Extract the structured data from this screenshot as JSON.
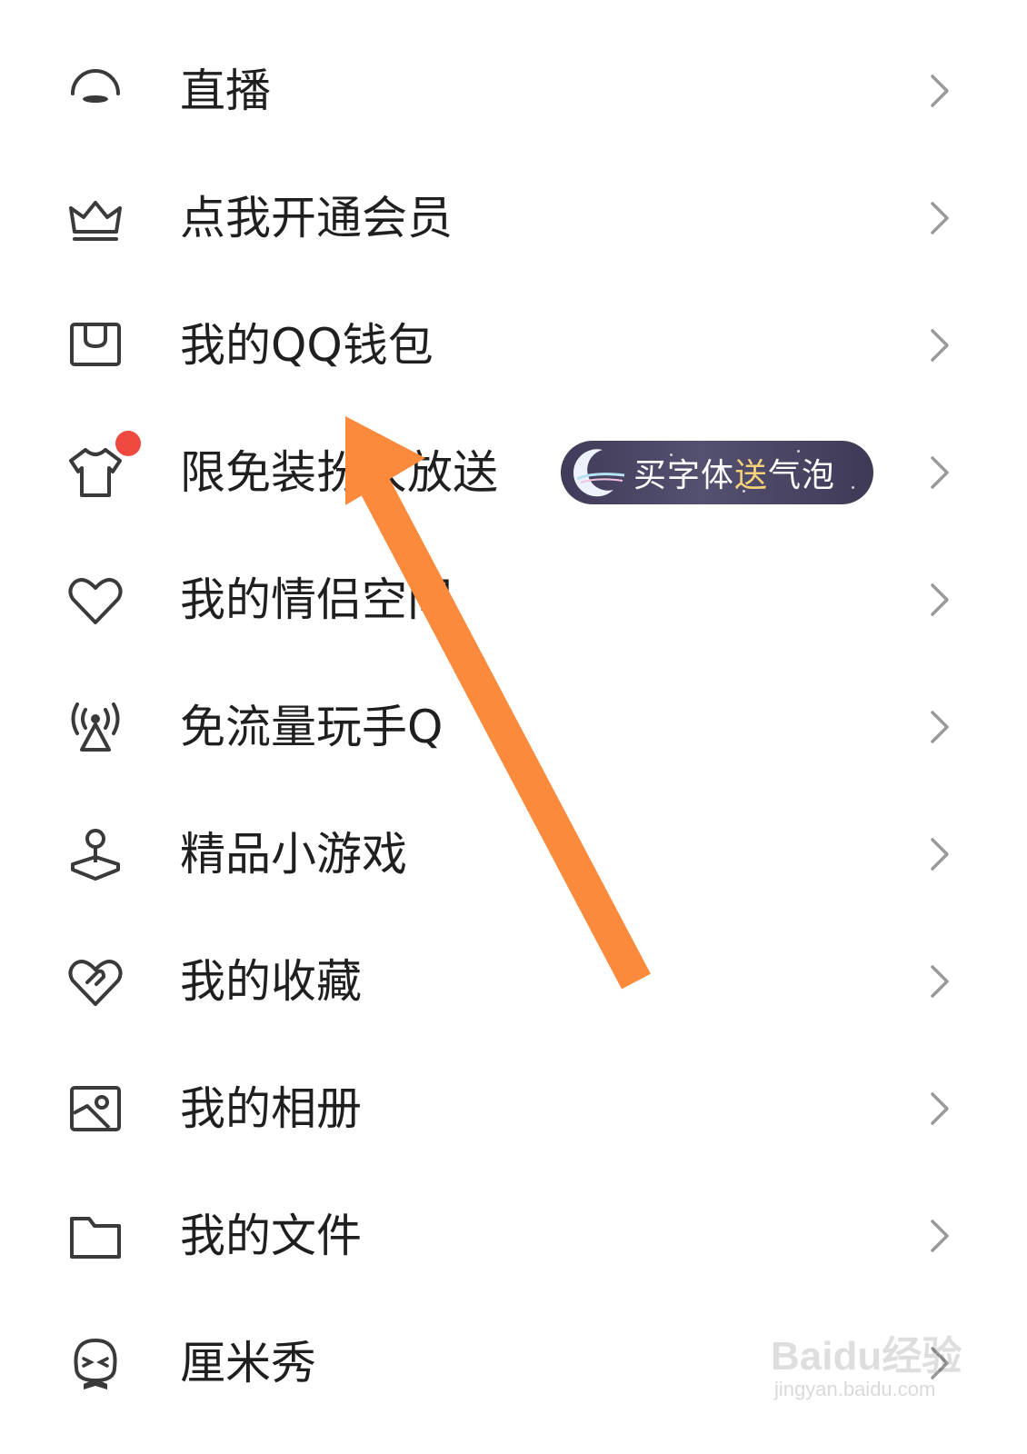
{
  "menu": {
    "items": [
      {
        "label": "直播",
        "icon": "live-icon"
      },
      {
        "label": "点我开通会员",
        "icon": "crown-icon"
      },
      {
        "label": "我的QQ钱包",
        "icon": "wallet-icon"
      },
      {
        "label": "限免装扮大放送",
        "icon": "tshirt-icon",
        "badge": "red-dot"
      },
      {
        "label": "我的情侣空间",
        "icon": "heart-icon"
      },
      {
        "label": "免流量玩手Q",
        "icon": "signal-tower-icon"
      },
      {
        "label": "精品小游戏",
        "icon": "joystick-icon"
      },
      {
        "label": "我的收藏",
        "icon": "favorite-heart-icon"
      },
      {
        "label": "我的相册",
        "icon": "photo-album-icon"
      },
      {
        "label": "我的文件",
        "icon": "folder-icon"
      },
      {
        "label": "厘米秀",
        "icon": "cmshow-icon"
      }
    ]
  },
  "promo": {
    "text_before": "买字体",
    "text_highlight": "送",
    "text_after": "气泡",
    "icon": "moon-icon",
    "highlight_color": "#f7d27a"
  },
  "annotation": {
    "type": "arrow",
    "color": "#fb8a3c"
  },
  "watermark": {
    "main": "Baidu经验",
    "sub": "jingyan.baidu.com"
  },
  "colors": {
    "text": "#1f1f1f",
    "icon": "#3a3a3a",
    "chevron": "#9a9a9a",
    "badge": "#f0493f"
  }
}
